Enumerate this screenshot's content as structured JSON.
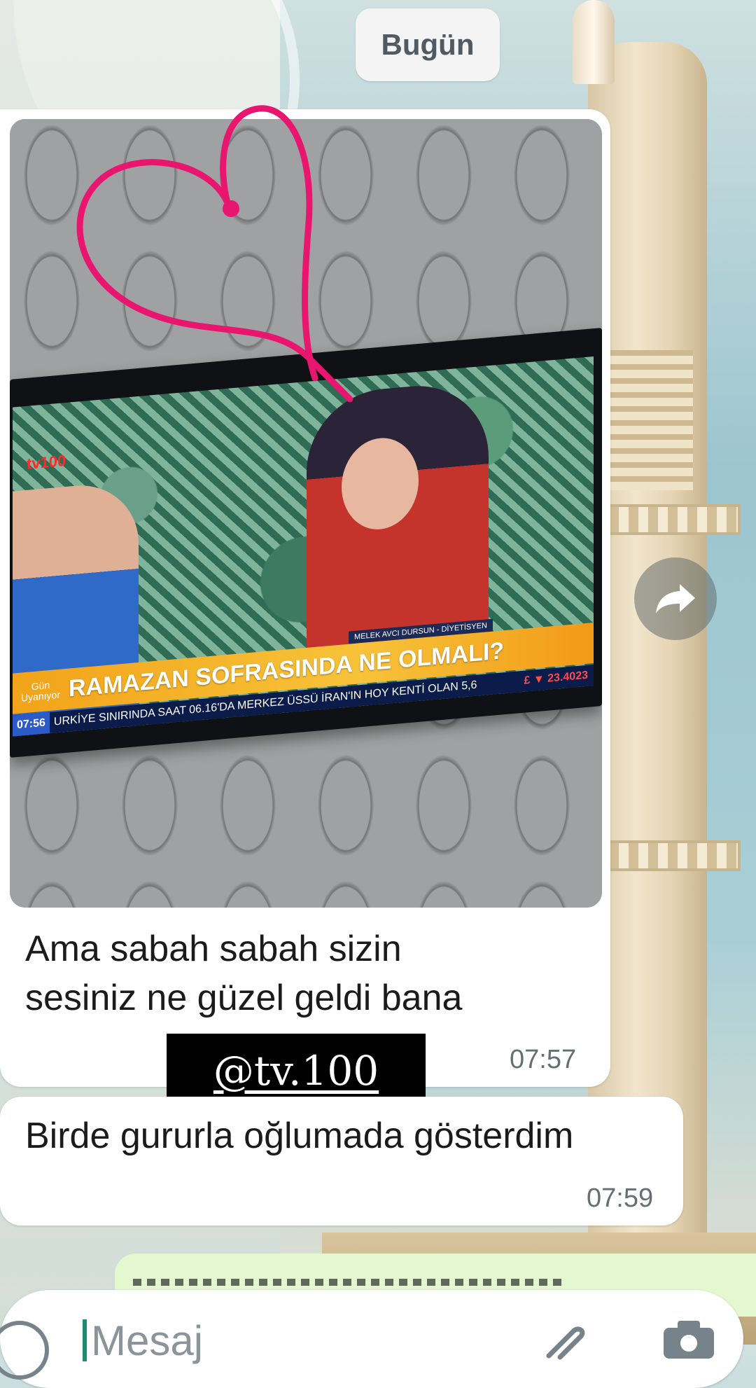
{
  "date_chip": "Bugün",
  "message1": {
    "text_line1": "Ama sabah sabah sizin",
    "text_line2": "sesiniz ne güzel geldi bana",
    "time": "07:57"
  },
  "photo": {
    "lower_third_logo_line1": "Gün",
    "lower_third_logo_line2": "Uyanıyor",
    "headline": "RAMAZAN SOFRASINDA NE OLMALI?",
    "name_tag": "MELEK AVCI DURSUN - DİYETİSYEN",
    "ticker_time": "07:56",
    "ticker_text": "URKİYE SINIRINDA SAAT 06.16'DA MERKEZ ÜSSÜ İRAN'IN HOY KENTİ OLAN 5,6",
    "ticker_rate": "£ ▼ 23.4023",
    "channel_logo": "tv100"
  },
  "watermark": "@tv.100",
  "message2": {
    "text": "Birde gururla oğlumada gösterdim",
    "time": "07:59"
  },
  "input": {
    "placeholder": "Mesaj"
  },
  "icons": {
    "forward": "forward-icon",
    "emoji": "emoji-icon",
    "attach": "paperclip-icon",
    "camera": "camera-icon"
  },
  "colors": {
    "bubble_incoming": "#ffffff",
    "bubble_outgoing": "#e3f8cf",
    "heart": "#e8166f",
    "accent": "#1b8c6e"
  }
}
